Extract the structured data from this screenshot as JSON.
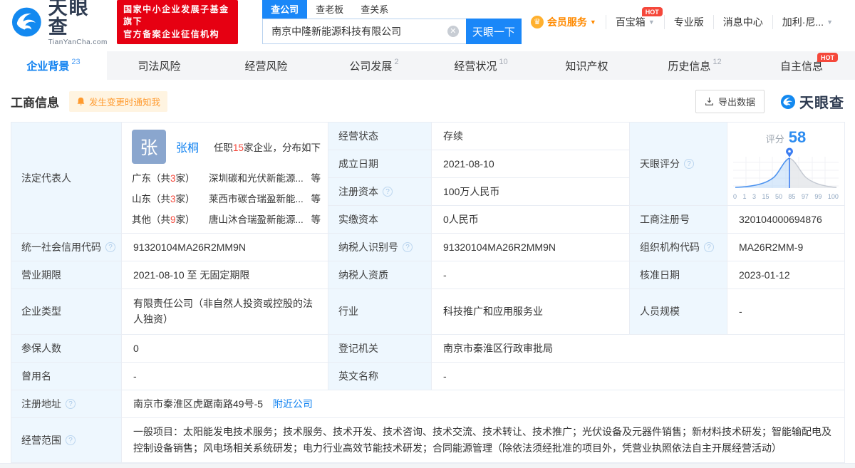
{
  "colors": {
    "accent": "#0e80f0",
    "brand_red": "#e60012",
    "hot_red": "#f5483b",
    "orange": "#ff9a2e",
    "label_bg": "#eef7fe",
    "score_blue": "#2d8cf0"
  },
  "icons": {
    "logo": "tianyancha-swirl",
    "help_glyph": "?",
    "caret": "▼",
    "clear_glyph": "✕",
    "crown_glyph": "♛",
    "bell": "bell",
    "download": "download-tray",
    "pin": "map-pin"
  },
  "header": {
    "logo": {
      "title": "天眼查",
      "subtitle": "TianYanCha.com"
    },
    "badge": {
      "line1": "国家中小企业发展子基金旗下",
      "line2": "官方备案企业征信机构"
    },
    "search": {
      "tabs": [
        {
          "label": "查公司"
        },
        {
          "label": "查老板"
        },
        {
          "label": "查关系"
        }
      ],
      "value": "南京中隆新能源科技有限公司",
      "button": "天眼一下"
    },
    "menu": {
      "vip": "会员服务",
      "toolbox": "百宝箱",
      "toolbox_badge": "HOT",
      "pro": "专业版",
      "messages": "消息中心",
      "user": "加利·尼..."
    }
  },
  "nav_tabs": [
    {
      "label": "企业背景",
      "count": "23"
    },
    {
      "label": "司法风险",
      "count": ""
    },
    {
      "label": "经营风险",
      "count": ""
    },
    {
      "label": "公司发展",
      "count": "2"
    },
    {
      "label": "经营状况",
      "count": "10"
    },
    {
      "label": "知识产权",
      "count": ""
    },
    {
      "label": "历史信息",
      "count": "12"
    },
    {
      "label": "自主信息",
      "count": "",
      "badge": "HOT"
    }
  ],
  "section": {
    "title": "工商信息",
    "notify_button": "发生变更时通知我",
    "export_button": "导出数据",
    "watermark": "天眼查"
  },
  "legal_rep": {
    "label": "法定代表人",
    "avatar_char": "张",
    "name": "张桐",
    "tenure_prefix": "任职",
    "tenure_count": "15",
    "tenure_suffix": "家企业，分布如下",
    "dist_open": "（共",
    "dist_close": "家）",
    "distribution": [
      {
        "region": "广东",
        "count": "3",
        "company": "深圳碳和光伏新能源...",
        "etc": "等"
      },
      {
        "region": "山东",
        "count": "3",
        "company": "莱西市碳合瑞盈新能...",
        "etc": "等"
      },
      {
        "region": "其他",
        "count": "9",
        "company": "唐山沐合瑞盈新能源...",
        "etc": "等"
      }
    ]
  },
  "score": {
    "label": "天眼评分",
    "score_label": "评分",
    "value": "58",
    "axis": [
      "0",
      "1",
      "3",
      "15",
      "50",
      "85",
      "97",
      "99",
      "100"
    ]
  },
  "fields": {
    "status": {
      "label": "经营状态",
      "value": "存续"
    },
    "founded": {
      "label": "成立日期",
      "value": "2021-08-10"
    },
    "reg_capital": {
      "label": "注册资本",
      "value": "100万人民币"
    },
    "paid_capital": {
      "label": "实缴资本",
      "value": "0人民币"
    },
    "reg_number": {
      "label": "工商注册号",
      "value": "320104000694876"
    },
    "credit_code": {
      "label": "统一社会信用代码",
      "value": "91320104MA26R2MM9N"
    },
    "taxpayer_id": {
      "label": "纳税人识别号",
      "value": "91320104MA26R2MM9N"
    },
    "org_code": {
      "label": "组织机构代码",
      "value": "MA26R2MM-9"
    },
    "term": {
      "label": "营业期限",
      "value": "2021-08-10 至 无固定期限"
    },
    "taxpayer_quality": {
      "label": "纳税人资质",
      "value": "-"
    },
    "approval_date": {
      "label": "核准日期",
      "value": "2023-01-12"
    },
    "company_type": {
      "label": "企业类型",
      "value": "有限责任公司（非自然人投资或控股的法人独资）"
    },
    "industry": {
      "label": "行业",
      "value": "科技推广和应用服务业"
    },
    "staff_size": {
      "label": "人员规模",
      "value": "-"
    },
    "insured_count": {
      "label": "参保人数",
      "value": "0"
    },
    "registry": {
      "label": "登记机关",
      "value": "南京市秦淮区行政审批局"
    },
    "former_name": {
      "label": "曾用名",
      "value": "-"
    },
    "english_name": {
      "label": "英文名称",
      "value": "-"
    },
    "address": {
      "label": "注册地址",
      "value": "南京市秦淮区虎踞南路49号-5",
      "link": "附近公司"
    },
    "scope": {
      "label": "经营范围",
      "value": "一般项目：太阳能发电技术服务；技术服务、技术开发、技术咨询、技术交流、技术转让、技术推广；光伏设备及元器件销售；新材料技术研发；智能输配电及控制设备销售；风电场相关系统研发；电力行业高效节能技术研发；合同能源管理（除依法须经批准的项目外，凭营业执照依法自主开展经营活动）"
    }
  }
}
